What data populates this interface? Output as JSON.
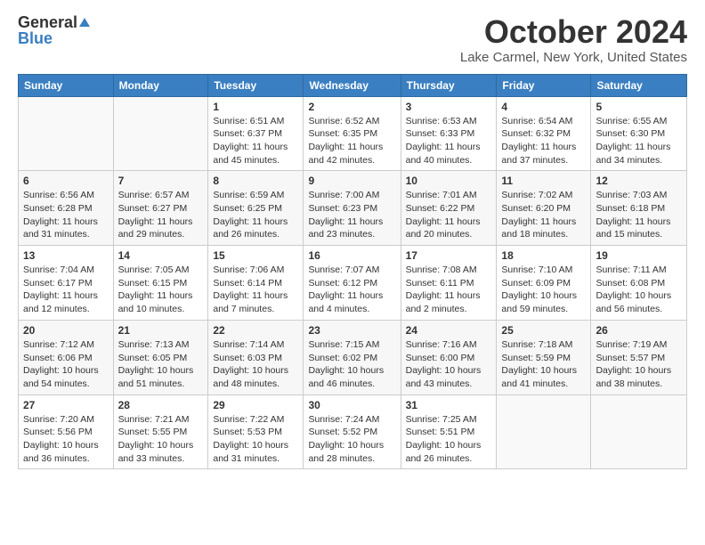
{
  "header": {
    "logo_general": "General",
    "logo_blue": "Blue",
    "month": "October 2024",
    "location": "Lake Carmel, New York, United States"
  },
  "weekdays": [
    "Sunday",
    "Monday",
    "Tuesday",
    "Wednesday",
    "Thursday",
    "Friday",
    "Saturday"
  ],
  "weeks": [
    [
      {
        "day": "",
        "sunrise": "",
        "sunset": "",
        "daylight": ""
      },
      {
        "day": "",
        "sunrise": "",
        "sunset": "",
        "daylight": ""
      },
      {
        "day": "1",
        "sunrise": "Sunrise: 6:51 AM",
        "sunset": "Sunset: 6:37 PM",
        "daylight": "Daylight: 11 hours and 45 minutes."
      },
      {
        "day": "2",
        "sunrise": "Sunrise: 6:52 AM",
        "sunset": "Sunset: 6:35 PM",
        "daylight": "Daylight: 11 hours and 42 minutes."
      },
      {
        "day": "3",
        "sunrise": "Sunrise: 6:53 AM",
        "sunset": "Sunset: 6:33 PM",
        "daylight": "Daylight: 11 hours and 40 minutes."
      },
      {
        "day": "4",
        "sunrise": "Sunrise: 6:54 AM",
        "sunset": "Sunset: 6:32 PM",
        "daylight": "Daylight: 11 hours and 37 minutes."
      },
      {
        "day": "5",
        "sunrise": "Sunrise: 6:55 AM",
        "sunset": "Sunset: 6:30 PM",
        "daylight": "Daylight: 11 hours and 34 minutes."
      }
    ],
    [
      {
        "day": "6",
        "sunrise": "Sunrise: 6:56 AM",
        "sunset": "Sunset: 6:28 PM",
        "daylight": "Daylight: 11 hours and 31 minutes."
      },
      {
        "day": "7",
        "sunrise": "Sunrise: 6:57 AM",
        "sunset": "Sunset: 6:27 PM",
        "daylight": "Daylight: 11 hours and 29 minutes."
      },
      {
        "day": "8",
        "sunrise": "Sunrise: 6:59 AM",
        "sunset": "Sunset: 6:25 PM",
        "daylight": "Daylight: 11 hours and 26 minutes."
      },
      {
        "day": "9",
        "sunrise": "Sunrise: 7:00 AM",
        "sunset": "Sunset: 6:23 PM",
        "daylight": "Daylight: 11 hours and 23 minutes."
      },
      {
        "day": "10",
        "sunrise": "Sunrise: 7:01 AM",
        "sunset": "Sunset: 6:22 PM",
        "daylight": "Daylight: 11 hours and 20 minutes."
      },
      {
        "day": "11",
        "sunrise": "Sunrise: 7:02 AM",
        "sunset": "Sunset: 6:20 PM",
        "daylight": "Daylight: 11 hours and 18 minutes."
      },
      {
        "day": "12",
        "sunrise": "Sunrise: 7:03 AM",
        "sunset": "Sunset: 6:18 PM",
        "daylight": "Daylight: 11 hours and 15 minutes."
      }
    ],
    [
      {
        "day": "13",
        "sunrise": "Sunrise: 7:04 AM",
        "sunset": "Sunset: 6:17 PM",
        "daylight": "Daylight: 11 hours and 12 minutes."
      },
      {
        "day": "14",
        "sunrise": "Sunrise: 7:05 AM",
        "sunset": "Sunset: 6:15 PM",
        "daylight": "Daylight: 11 hours and 10 minutes."
      },
      {
        "day": "15",
        "sunrise": "Sunrise: 7:06 AM",
        "sunset": "Sunset: 6:14 PM",
        "daylight": "Daylight: 11 hours and 7 minutes."
      },
      {
        "day": "16",
        "sunrise": "Sunrise: 7:07 AM",
        "sunset": "Sunset: 6:12 PM",
        "daylight": "Daylight: 11 hours and 4 minutes."
      },
      {
        "day": "17",
        "sunrise": "Sunrise: 7:08 AM",
        "sunset": "Sunset: 6:11 PM",
        "daylight": "Daylight: 11 hours and 2 minutes."
      },
      {
        "day": "18",
        "sunrise": "Sunrise: 7:10 AM",
        "sunset": "Sunset: 6:09 PM",
        "daylight": "Daylight: 10 hours and 59 minutes."
      },
      {
        "day": "19",
        "sunrise": "Sunrise: 7:11 AM",
        "sunset": "Sunset: 6:08 PM",
        "daylight": "Daylight: 10 hours and 56 minutes."
      }
    ],
    [
      {
        "day": "20",
        "sunrise": "Sunrise: 7:12 AM",
        "sunset": "Sunset: 6:06 PM",
        "daylight": "Daylight: 10 hours and 54 minutes."
      },
      {
        "day": "21",
        "sunrise": "Sunrise: 7:13 AM",
        "sunset": "Sunset: 6:05 PM",
        "daylight": "Daylight: 10 hours and 51 minutes."
      },
      {
        "day": "22",
        "sunrise": "Sunrise: 7:14 AM",
        "sunset": "Sunset: 6:03 PM",
        "daylight": "Daylight: 10 hours and 48 minutes."
      },
      {
        "day": "23",
        "sunrise": "Sunrise: 7:15 AM",
        "sunset": "Sunset: 6:02 PM",
        "daylight": "Daylight: 10 hours and 46 minutes."
      },
      {
        "day": "24",
        "sunrise": "Sunrise: 7:16 AM",
        "sunset": "Sunset: 6:00 PM",
        "daylight": "Daylight: 10 hours and 43 minutes."
      },
      {
        "day": "25",
        "sunrise": "Sunrise: 7:18 AM",
        "sunset": "Sunset: 5:59 PM",
        "daylight": "Daylight: 10 hours and 41 minutes."
      },
      {
        "day": "26",
        "sunrise": "Sunrise: 7:19 AM",
        "sunset": "Sunset: 5:57 PM",
        "daylight": "Daylight: 10 hours and 38 minutes."
      }
    ],
    [
      {
        "day": "27",
        "sunrise": "Sunrise: 7:20 AM",
        "sunset": "Sunset: 5:56 PM",
        "daylight": "Daylight: 10 hours and 36 minutes."
      },
      {
        "day": "28",
        "sunrise": "Sunrise: 7:21 AM",
        "sunset": "Sunset: 5:55 PM",
        "daylight": "Daylight: 10 hours and 33 minutes."
      },
      {
        "day": "29",
        "sunrise": "Sunrise: 7:22 AM",
        "sunset": "Sunset: 5:53 PM",
        "daylight": "Daylight: 10 hours and 31 minutes."
      },
      {
        "day": "30",
        "sunrise": "Sunrise: 7:24 AM",
        "sunset": "Sunset: 5:52 PM",
        "daylight": "Daylight: 10 hours and 28 minutes."
      },
      {
        "day": "31",
        "sunrise": "Sunrise: 7:25 AM",
        "sunset": "Sunset: 5:51 PM",
        "daylight": "Daylight: 10 hours and 26 minutes."
      },
      {
        "day": "",
        "sunrise": "",
        "sunset": "",
        "daylight": ""
      },
      {
        "day": "",
        "sunrise": "",
        "sunset": "",
        "daylight": ""
      }
    ]
  ]
}
